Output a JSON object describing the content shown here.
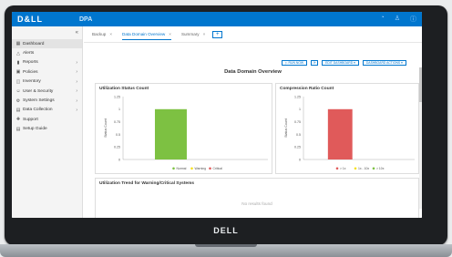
{
  "device": {
    "brand": "DELL"
  },
  "app": {
    "logo": "D&LL",
    "name": "DPA"
  },
  "top_icons": [
    {
      "name": "bell-icon",
      "glyph": "◔"
    },
    {
      "name": "user-icon",
      "glyph": "♙"
    },
    {
      "name": "help-icon",
      "glyph": "ⓘ"
    }
  ],
  "sidebar": {
    "collapse_glyph": "«",
    "items": [
      {
        "label": "Dashboard",
        "icon": "dashboard-icon",
        "glyph": "▦",
        "chevron": false,
        "active": true
      },
      {
        "label": "Alerts",
        "icon": "alert-icon",
        "glyph": "△",
        "chevron": false
      },
      {
        "label": "Reports",
        "icon": "reports-icon",
        "glyph": "▮",
        "chevron": true
      },
      {
        "label": "Policies",
        "icon": "policies-icon",
        "glyph": "▣",
        "chevron": true
      },
      {
        "label": "Inventory",
        "icon": "inventory-icon",
        "glyph": "◫",
        "chevron": true
      },
      {
        "label": "User & Security",
        "icon": "user-security-icon",
        "glyph": "☺",
        "chevron": true
      },
      {
        "label": "System Settings",
        "icon": "settings-icon",
        "glyph": "⚙",
        "chevron": true
      },
      {
        "label": "Data Collection",
        "icon": "data-collection-icon",
        "glyph": "▤",
        "chevron": true
      },
      {
        "label": "Support",
        "icon": "support-icon",
        "glyph": "✚",
        "chevron": false
      },
      {
        "label": "Setup Guide",
        "icon": "setup-icon",
        "glyph": "▤",
        "chevron": false
      }
    ]
  },
  "tabs": [
    {
      "label": "Backup",
      "close": "×",
      "active": false
    },
    {
      "label": "Data Domain Overview",
      "close": "×",
      "active": true
    },
    {
      "label": "Summary",
      "close": "×",
      "active": false
    }
  ],
  "tab_add": "+",
  "toolbar": {
    "run_now": "▷ RUN NOW",
    "refresh": "⟳",
    "edit_dashboard": "EDIT DASHBOARD ▾",
    "dashboard_actions": "DASHBOARD ACTIONS ▾"
  },
  "dashboard_title": "Data Domain Overview",
  "trend": {
    "title": "Utilization Trend for Warning/Critical Systems",
    "empty_text": "No results found"
  },
  "chart_data": [
    {
      "type": "bar",
      "title": "Utilization Status Count",
      "ylabel": "Status Count",
      "xlabel": "",
      "categories": [
        "Normal"
      ],
      "series": [
        {
          "name": "Normal",
          "values": [
            1
          ],
          "color": "#7dc142"
        },
        {
          "name": "Warning",
          "values": [
            0
          ],
          "color": "#f5e01b"
        },
        {
          "name": "Critical",
          "values": [
            0
          ],
          "color": "#e05a5a"
        }
      ],
      "ylim": [
        0,
        1.25
      ],
      "yticks": [
        0,
        0.25,
        0.5,
        0.75,
        1,
        1.25
      ],
      "ytick_labels": [
        "0",
        "0.25",
        "0.5",
        "0.75",
        "1",
        "1.25"
      ],
      "legend": "bottom",
      "grid": false
    },
    {
      "type": "bar",
      "title": "Compression Ratio Count",
      "ylabel": "Status Count",
      "xlabel": "",
      "categories": [
        "> 1x"
      ],
      "series": [
        {
          "name": "> 1x",
          "values": [
            1
          ],
          "color": "#e05a5a"
        },
        {
          "name": "1x - 10x",
          "values": [
            0
          ],
          "color": "#f5e01b"
        },
        {
          "name": "> 10x",
          "values": [
            0
          ],
          "color": "#7dc142"
        }
      ],
      "ylim": [
        0,
        1.25
      ],
      "yticks": [
        0,
        0.25,
        0.5,
        0.75,
        1,
        1.25
      ],
      "ytick_labels": [
        "0",
        "0.25",
        "0.5",
        "0.75",
        "1",
        "1.25"
      ],
      "legend": "bottom",
      "grid": false
    }
  ]
}
